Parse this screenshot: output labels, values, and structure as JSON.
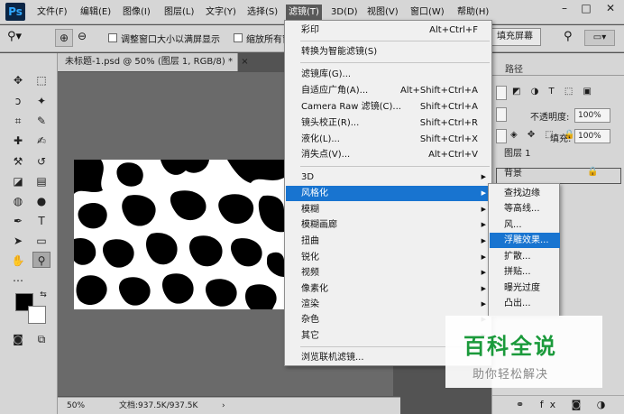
{
  "app": {
    "logo": "Ps"
  },
  "menubar": {
    "items": [
      "文件(F)",
      "编辑(E)",
      "图像(I)",
      "图层(L)",
      "文字(Y)",
      "选择(S)",
      "滤镜(T)",
      "3D(D)",
      "视图(V)",
      "窗口(W)",
      "帮助(H)"
    ],
    "active_index": 6
  },
  "options": {
    "resize_windows": "调整窗口大小以满屏显示",
    "zoom_all": "缩放所有窗口",
    "fill_screen": "填充屏幕"
  },
  "document": {
    "tab_title": "未标题-1.psd @ 50% (图层 1, RGB/8) *",
    "zoom": "50%",
    "doc_info": "文档:937.5K/937.5K"
  },
  "filter_menu": {
    "items": [
      {
        "label": "彩印",
        "shortcut": "Alt+Ctrl+F"
      },
      {
        "label": "转换为智能滤镜(S)",
        "shortcut": ""
      },
      {
        "label": "滤镜库(G)...",
        "shortcut": ""
      },
      {
        "label": "自适应广角(A)...",
        "shortcut": "Alt+Shift+Ctrl+A"
      },
      {
        "label": "Camera Raw 滤镜(C)...",
        "shortcut": "Shift+Ctrl+A"
      },
      {
        "label": "镜头校正(R)...",
        "shortcut": "Shift+Ctrl+R"
      },
      {
        "label": "液化(L)...",
        "shortcut": "Shift+Ctrl+X"
      },
      {
        "label": "消失点(V)...",
        "shortcut": "Alt+Ctrl+V"
      },
      {
        "label": "3D",
        "shortcut": ""
      },
      {
        "label": "风格化",
        "shortcut": ""
      },
      {
        "label": "模糊",
        "shortcut": ""
      },
      {
        "label": "模糊画廊",
        "shortcut": ""
      },
      {
        "label": "扭曲",
        "shortcut": ""
      },
      {
        "label": "锐化",
        "shortcut": ""
      },
      {
        "label": "视频",
        "shortcut": ""
      },
      {
        "label": "像素化",
        "shortcut": ""
      },
      {
        "label": "渲染",
        "shortcut": ""
      },
      {
        "label": "杂色",
        "shortcut": ""
      },
      {
        "label": "其它",
        "shortcut": ""
      },
      {
        "label": "浏览联机滤镜...",
        "shortcut": ""
      }
    ]
  },
  "stylize_submenu": {
    "items": [
      "查找边缘",
      "等高线...",
      "风...",
      "浮雕效果...",
      "扩散...",
      "拼贴...",
      "曝光过度",
      "凸出..."
    ],
    "highlight_index": 3
  },
  "panels": {
    "paths_tab": "路径",
    "opacity_label": "不透明度:",
    "opacity_value": "100%",
    "fill_label": "填充:",
    "fill_value": "100%",
    "layer1": "图层 1",
    "background": "背景"
  },
  "watermark": {
    "title": "百科全说",
    "subtitle": "助你轻松解决"
  },
  "colors": {
    "highlight": "#1874d0",
    "watermark_green": "#1b9a3b"
  }
}
